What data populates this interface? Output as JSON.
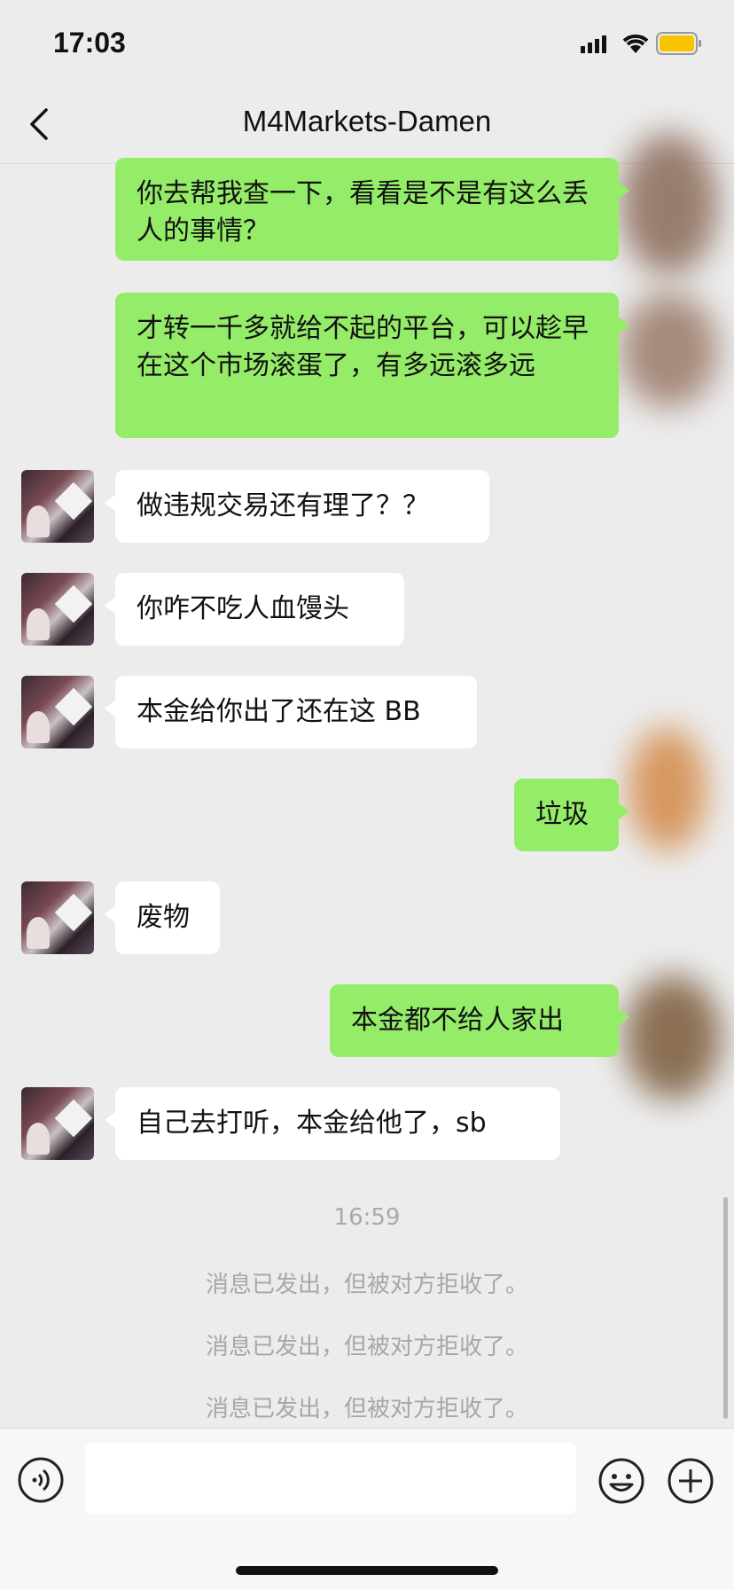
{
  "status": {
    "time": "17:03"
  },
  "nav": {
    "title": "M4Markets-Damen"
  },
  "messages": [
    {
      "from": "me",
      "text": "你去帮我查一下，看看是不是有这么丢人的事情？"
    },
    {
      "from": "me",
      "text": "才转一千多就给不起的平台，可以趁早在这个市场滚蛋了，有多远滚多远"
    },
    {
      "from": "them",
      "text": "做违规交易还有理了？？"
    },
    {
      "from": "them",
      "text": "你咋不吃人血馒头"
    },
    {
      "from": "them",
      "text": "本金给你出了还在这 BB"
    },
    {
      "from": "me",
      "text": "垃圾"
    },
    {
      "from": "them",
      "text": "废物"
    },
    {
      "from": "me",
      "text": "本金都不给人家出"
    },
    {
      "from": "them",
      "text": "自己去打听，本金给他了，sb"
    }
  ],
  "timestamp": "16:59",
  "system_notices": [
    "消息已发出，但被对方拒收了。",
    "消息已发出，但被对方拒收了。",
    "消息已发出，但被对方拒收了。"
  ],
  "colors": {
    "me_bubble": "#95ec69",
    "them_bubble": "#ffffff",
    "background": "#ececec"
  },
  "icons": {
    "back": "chevron-left-icon",
    "voice": "voice-icon",
    "emoji": "emoji-icon",
    "plus": "plus-icon"
  }
}
